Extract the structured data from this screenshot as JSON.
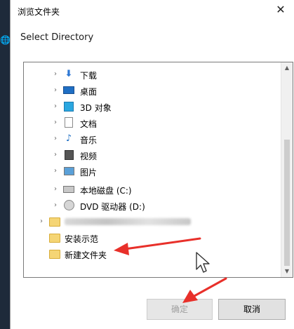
{
  "dialog": {
    "title": "浏览文件夹",
    "close_glyph": "✕",
    "prompt": "Select Directory"
  },
  "tree": {
    "items": [
      {
        "label": "下载",
        "icon": "download-icon"
      },
      {
        "label": "桌面",
        "icon": "desktop-icon"
      },
      {
        "label": "3D 对象",
        "icon": "3d-objects-icon"
      },
      {
        "label": "文档",
        "icon": "document-icon"
      },
      {
        "label": "音乐",
        "icon": "music-icon"
      },
      {
        "label": "视频",
        "icon": "video-icon"
      },
      {
        "label": "图片",
        "icon": "pictures-icon"
      },
      {
        "label": "本地磁盘 (C:)",
        "icon": "local-disk-icon"
      },
      {
        "label": "DVD 驱动器 (D:)",
        "icon": "dvd-drive-icon"
      },
      {
        "label": "安装示范",
        "icon": "folder-icon"
      },
      {
        "label": "新建文件夹",
        "icon": "folder-icon"
      }
    ],
    "scroll_up_glyph": "▲",
    "scroll_down_glyph": "▼",
    "chevron_glyph": "›"
  },
  "buttons": {
    "ok_label": "确定",
    "cancel_label": "取消"
  },
  "colors": {
    "annotation_arrow": "#e8302a",
    "folder": "#f5d575"
  }
}
